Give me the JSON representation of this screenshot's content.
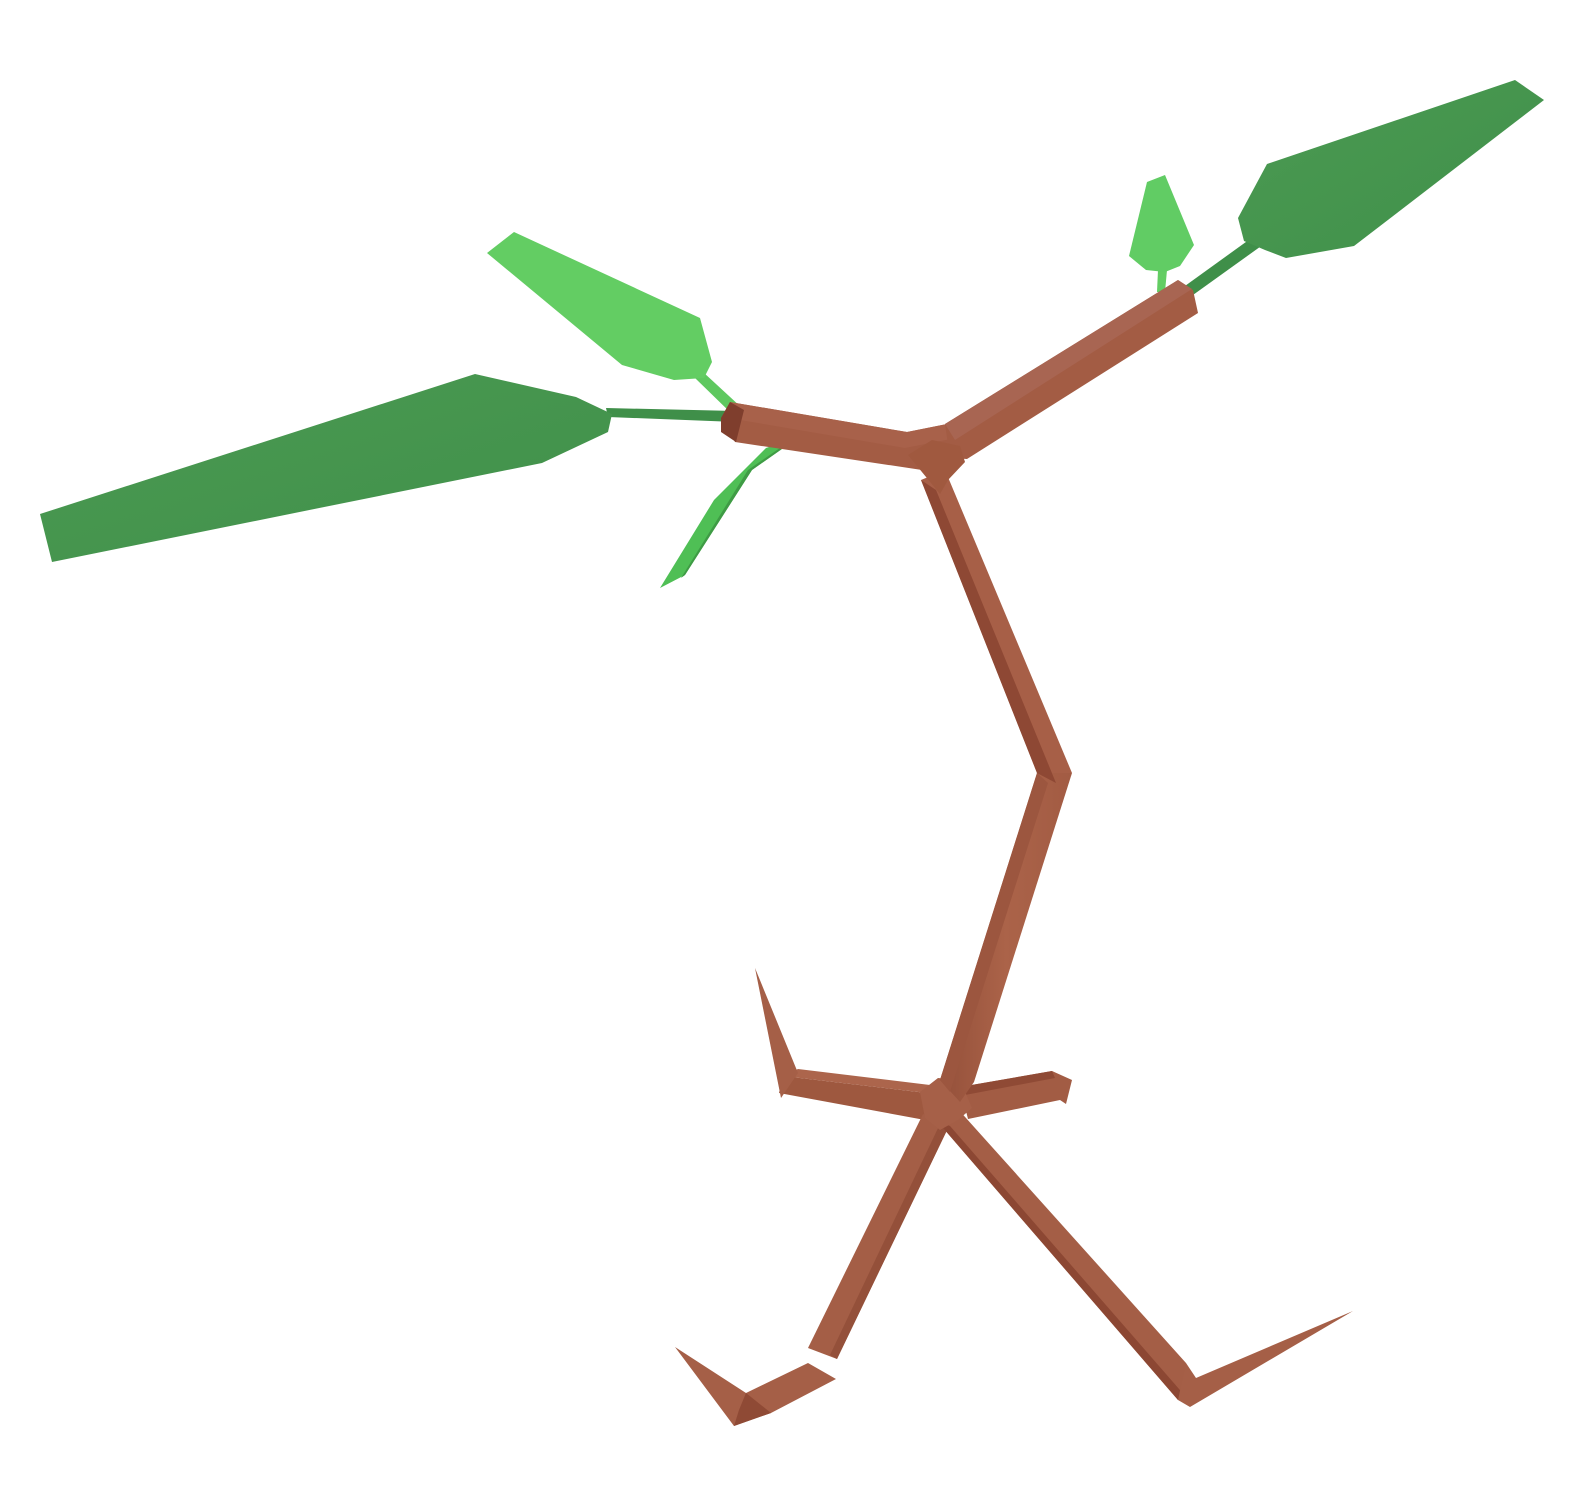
{
  "scene": {
    "subject": "low-poly-plant-creature",
    "background_color": "#ffffff"
  },
  "colors": {
    "bark": "#a75f47",
    "bark_light": "#ac654c",
    "bark_dark": "#8f4a35",
    "bark_shadow": "#7f3e2d",
    "leaf_dark": "#47954f",
    "leaf_dark_shade": "#3f8f49",
    "leaf_light": "#63cd63",
    "leaf_mid": "#4fbf55",
    "leaf_stem": "#3f8f49"
  }
}
